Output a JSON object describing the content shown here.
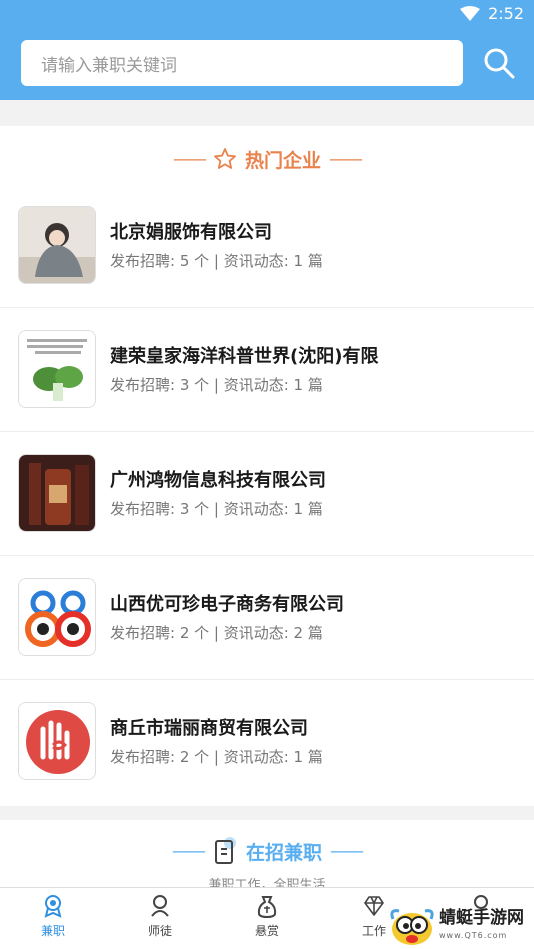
{
  "status_bar": {
    "time": "2:52",
    "wifi_icon": "wifi-icon",
    "battery_icon": "battery-icon"
  },
  "search": {
    "placeholder": "请输入兼职关键词",
    "icon": "search-icon"
  },
  "hot_companies": {
    "title": "热门企业",
    "dash_left": "——",
    "dash_right": "——",
    "icon": "star-icon",
    "items": [
      {
        "name": "北京娟服饰有限公司",
        "meta": "发布招聘: 5 个 | 资讯动态: 1 篇"
      },
      {
        "name": "建荣皇家海洋科普世界(沈阳)有限",
        "meta": "发布招聘: 3 个 | 资讯动态: 1 篇"
      },
      {
        "name": "广州鸿物信息科技有限公司",
        "meta": "发布招聘: 3 个 | 资讯动态: 1 篇"
      },
      {
        "name": "山西优可珍电子商务有限公司",
        "meta": "发布招聘: 2 个 | 资讯动态: 2 篇"
      },
      {
        "name": "商丘市瑞丽商贸有限公司",
        "meta": "发布招聘: 2 个 | 资讯动态: 1 篇"
      }
    ]
  },
  "recruiting": {
    "title": "在招兼职",
    "dash_left": "——",
    "dash_right": "——",
    "subtitle": "兼职工作，全职生活",
    "icon": "clipboard-icon"
  },
  "tabbar": {
    "tabs": [
      {
        "label": "兼职",
        "icon": "badge-icon",
        "active": true
      },
      {
        "label": "师徒",
        "icon": "mentor-icon",
        "active": false
      },
      {
        "label": "悬赏",
        "icon": "moneybag-icon",
        "active": false
      },
      {
        "label": "工作",
        "icon": "diamond-icon",
        "active": false
      },
      {
        "label": "",
        "icon": "profile-icon",
        "active": false
      }
    ]
  },
  "watermark": {
    "text": "蜻蜓手游网",
    "url": "www.QT6.com"
  },
  "colors": {
    "header": "#59aef0",
    "hot_accent": "#e9834d",
    "active_tab": "#2f8fe0"
  }
}
